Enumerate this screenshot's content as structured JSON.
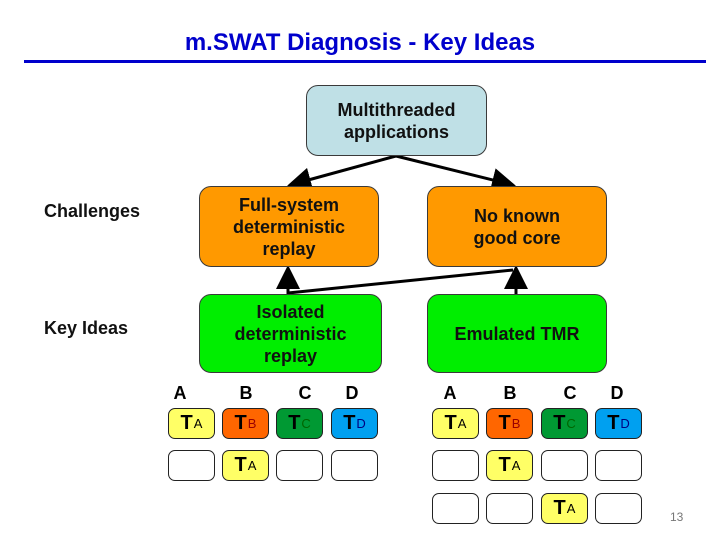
{
  "title": "m.SWAT Diagnosis - Key Ideas",
  "colors": {
    "title": "#0000cc",
    "root_box": "#bfe0e6",
    "challenge_box": "#ff9900",
    "key_idea_box": "#00ee00",
    "thread_A": "#ffff66",
    "thread_B": "#ff6600",
    "thread_C": "#009933",
    "thread_D": "#00a0f0",
    "sub_A": "#000000",
    "sub_B": "#990000",
    "sub_C": "#006600",
    "sub_D": "#000080"
  },
  "root": {
    "label": "Multithreaded\napplications"
  },
  "row_labels": {
    "challenges": "Challenges",
    "key_ideas": "Key Ideas"
  },
  "challenges": [
    {
      "label": "Full-system\ndeterministic\nreplay"
    },
    {
      "label": "No known\ngood core"
    }
  ],
  "key_ideas": [
    {
      "label": "Isolated\ndeterministic\nreplay"
    },
    {
      "label": "Emulated TMR"
    }
  ],
  "grids": [
    {
      "columns": [
        "A",
        "B",
        "C",
        "D"
      ],
      "rows": [
        [
          {
            "t": "T",
            "s": "A",
            "c": "A"
          },
          {
            "t": "T",
            "s": "B",
            "c": "B"
          },
          {
            "t": "T",
            "s": "C",
            "c": "C"
          },
          {
            "t": "T",
            "s": "D",
            "c": "D"
          }
        ],
        [
          null,
          {
            "t": "T",
            "s": "A",
            "c": "A"
          },
          null,
          null
        ]
      ]
    },
    {
      "columns": [
        "A",
        "B",
        "C",
        "D"
      ],
      "rows": [
        [
          {
            "t": "T",
            "s": "A",
            "c": "A"
          },
          {
            "t": "T",
            "s": "B",
            "c": "B"
          },
          {
            "t": "T",
            "s": "C",
            "c": "C"
          },
          {
            "t": "T",
            "s": "D",
            "c": "D"
          }
        ],
        [
          null,
          {
            "t": "T",
            "s": "A",
            "c": "A"
          },
          null,
          null
        ],
        [
          null,
          null,
          {
            "t": "T",
            "s": "A",
            "c": "A"
          },
          null
        ]
      ]
    }
  ],
  "page_number": "13"
}
